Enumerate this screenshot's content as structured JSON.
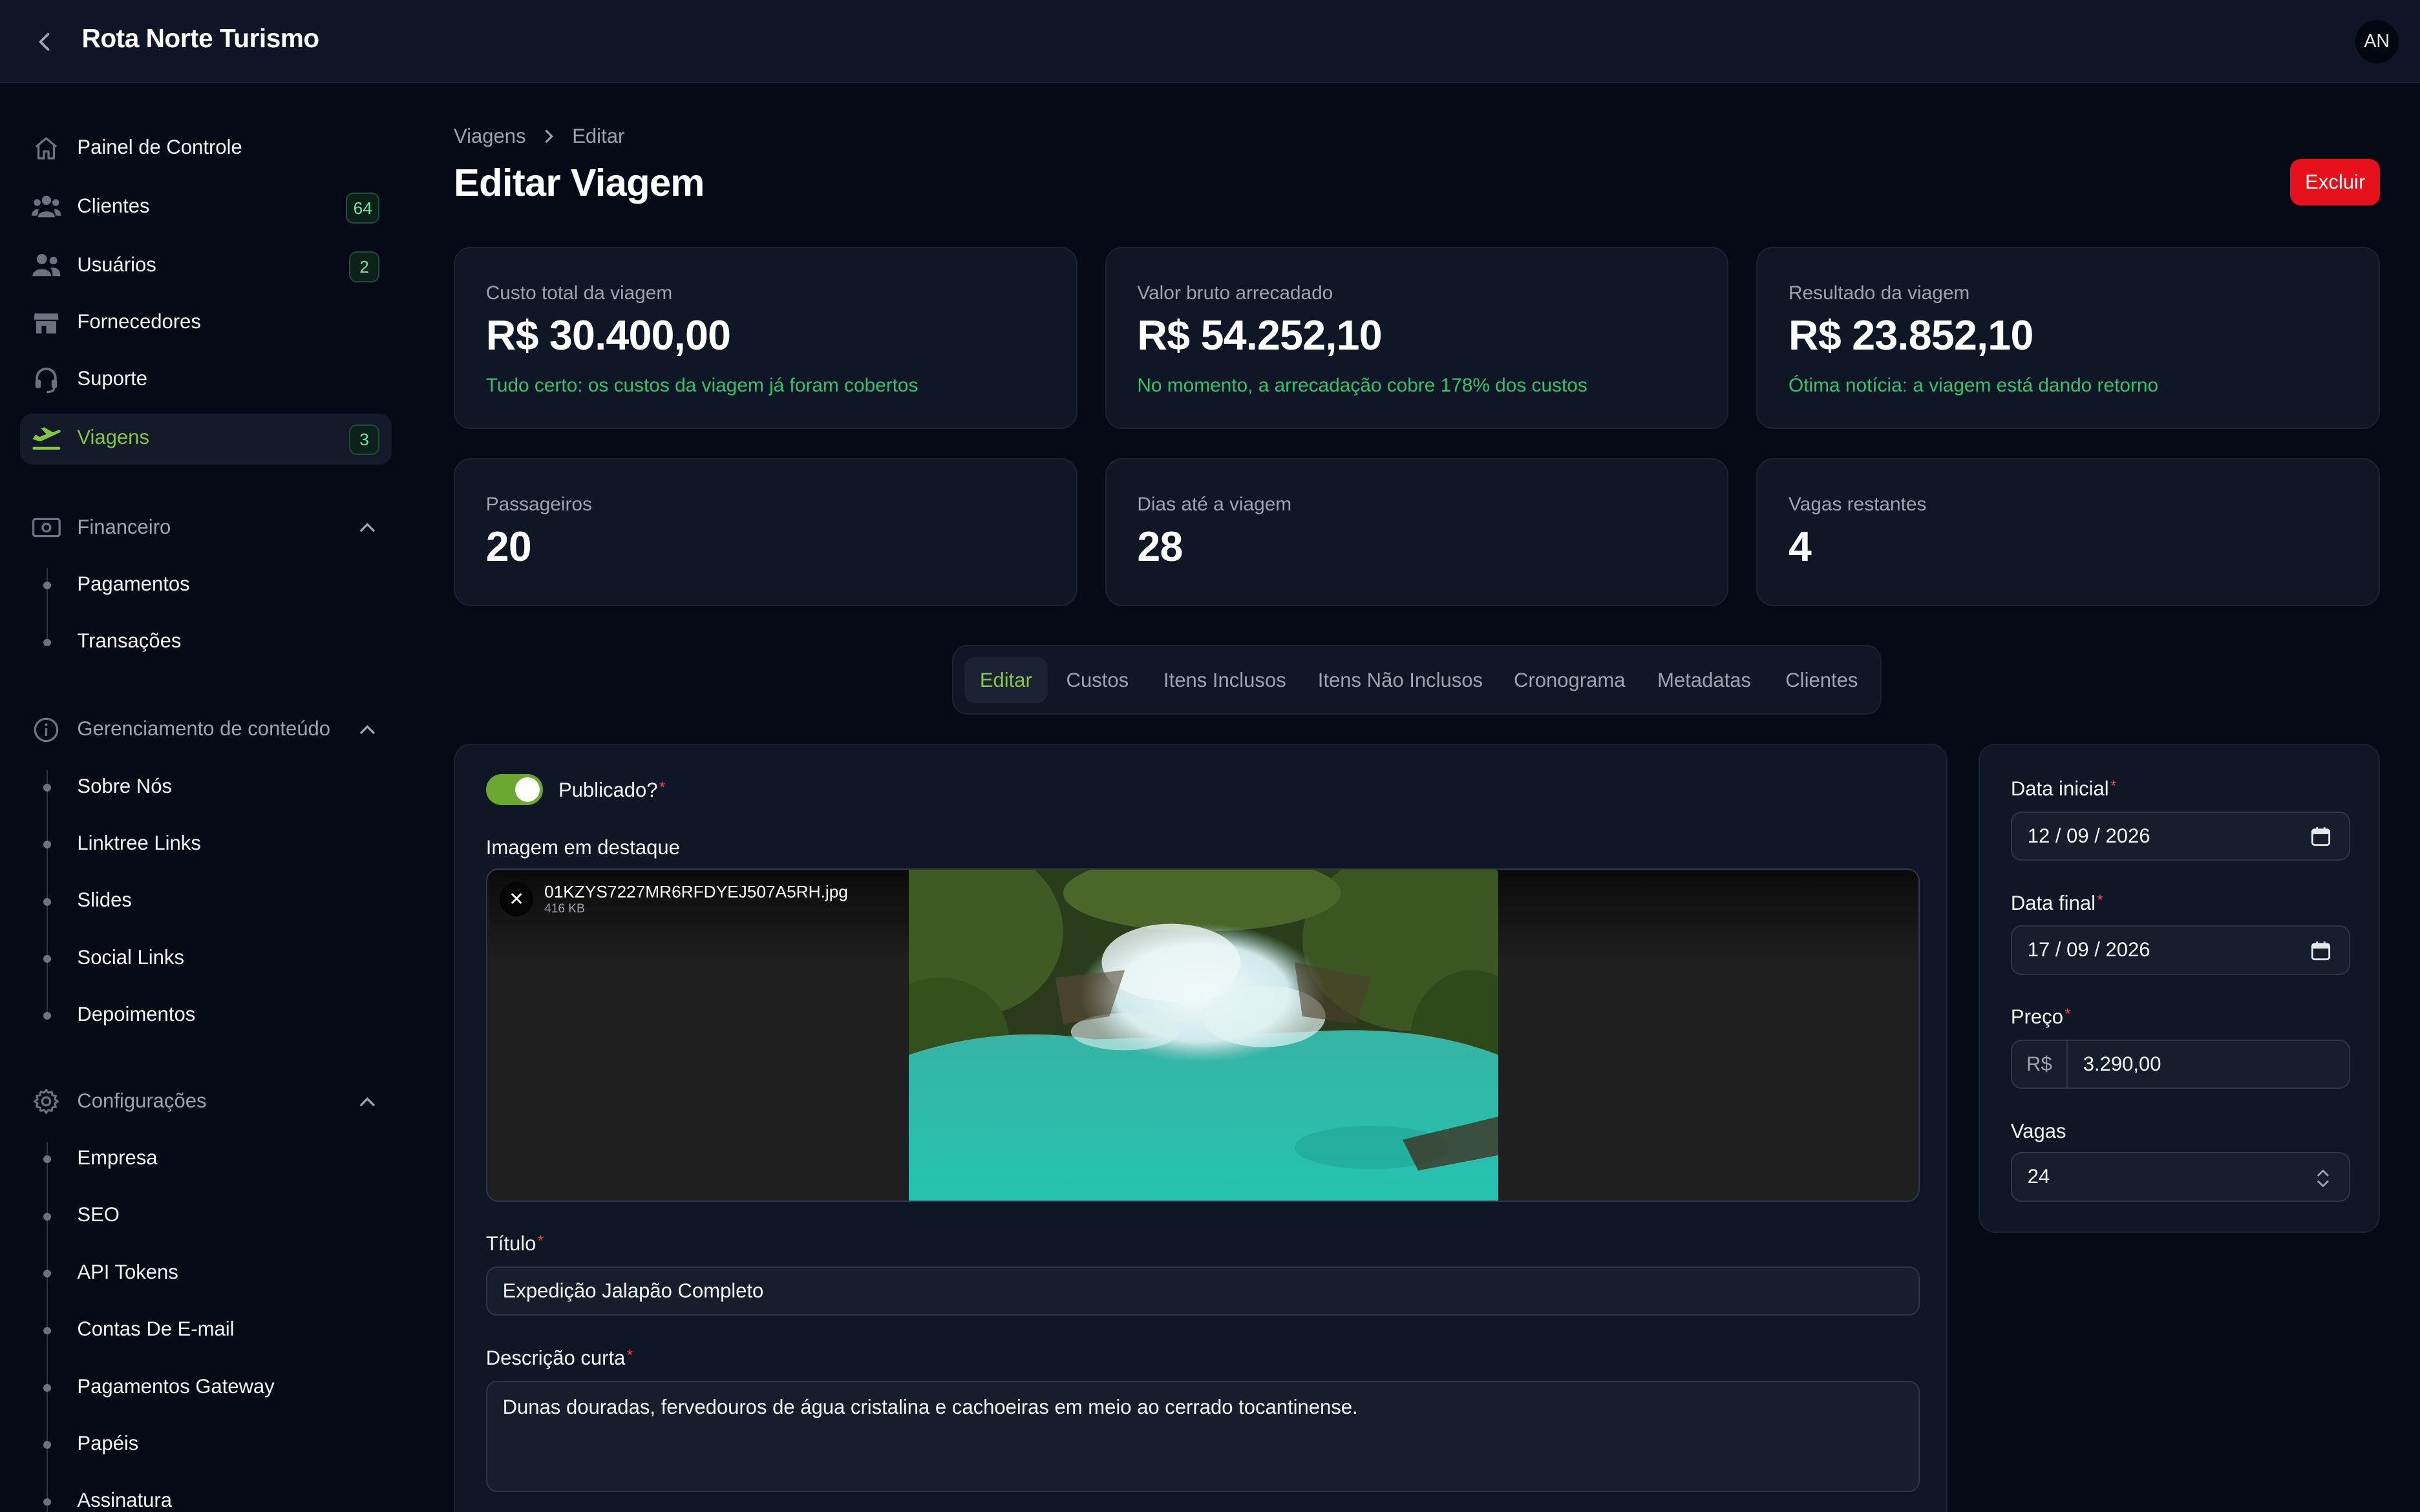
{
  "app": {
    "title": "Rota Norte Turismo",
    "user_initials": "AN"
  },
  "sidebar": {
    "items": [
      {
        "label": "Painel de Controle",
        "icon": "home-icon"
      },
      {
        "label": "Clientes",
        "icon": "users-icon",
        "badge": "64"
      },
      {
        "label": "Usuários",
        "icon": "user-group-icon",
        "badge": "2"
      },
      {
        "label": "Fornecedores",
        "icon": "store-icon"
      },
      {
        "label": "Suporte",
        "icon": "headset-icon"
      },
      {
        "label": "Viagens",
        "icon": "airplane-icon",
        "badge": "3",
        "active": true
      }
    ],
    "groups": [
      {
        "label": "Financeiro",
        "icon": "banknote-icon",
        "items": [
          "Pagamentos",
          "Transações"
        ]
      },
      {
        "label": "Gerenciamento de conteúdo",
        "icon": "info-icon",
        "items": [
          "Sobre Nós",
          "Linktree Links",
          "Slides",
          "Social Links",
          "Depoimentos"
        ]
      },
      {
        "label": "Configurações",
        "icon": "gear-icon",
        "items": [
          "Empresa",
          "SEO",
          "API Tokens",
          "Contas De E-mail",
          "Pagamentos Gateway",
          "Papéis",
          "Assinatura"
        ]
      }
    ]
  },
  "breadcrumb": {
    "parent": "Viagens",
    "current": "Editar"
  },
  "page": {
    "title": "Editar Viagem",
    "delete_label": "Excluir"
  },
  "stats": [
    {
      "label": "Custo total da viagem",
      "value": "R$ 30.400,00",
      "desc": "Tudo certo: os custos da viagem já foram cobertos"
    },
    {
      "label": "Valor bruto arrecadado",
      "value": "R$ 54.252,10",
      "desc": "No momento, a arrecadação cobre 178% dos custos"
    },
    {
      "label": "Resultado da viagem",
      "value": "R$ 23.852,10",
      "desc": "Ótima notícia: a viagem está dando retorno"
    },
    {
      "label": "Passageiros",
      "value": "20"
    },
    {
      "label": "Dias até a viagem",
      "value": "28"
    },
    {
      "label": "Vagas restantes",
      "value": "4"
    }
  ],
  "tabs": [
    "Editar",
    "Custos",
    "Itens Inclusos",
    "Itens Não Inclusos",
    "Cronograma",
    "Metadatas",
    "Clientes"
  ],
  "form": {
    "published_label": "Publicado?",
    "published": true,
    "image_label": "Imagem em destaque",
    "image_file": "01KZYS7227MR6RFDYEJ507A5RH.jpg",
    "image_size": "416 KB",
    "title_label": "Título",
    "title_value": "Expedição Jalapão Completo",
    "desc_label": "Descrição curta",
    "desc_value": "Dunas douradas, fervedouros de água cristalina e cachoeiras em meio ao cerrado tocantinense."
  },
  "side": {
    "start_label": "Data inicial",
    "start_value": "12 / 09 / 2026",
    "end_label": "Data final",
    "end_value": "17 / 09 / 2026",
    "price_label": "Preço",
    "price_prefix": "R$",
    "price_value": "3.290,00",
    "seats_label": "Vagas",
    "seats_value": "24"
  },
  "colors": {
    "accent": "#86c540",
    "success": "#32c46b",
    "danger": "#e5101a",
    "toggle": "#6aa832"
  }
}
